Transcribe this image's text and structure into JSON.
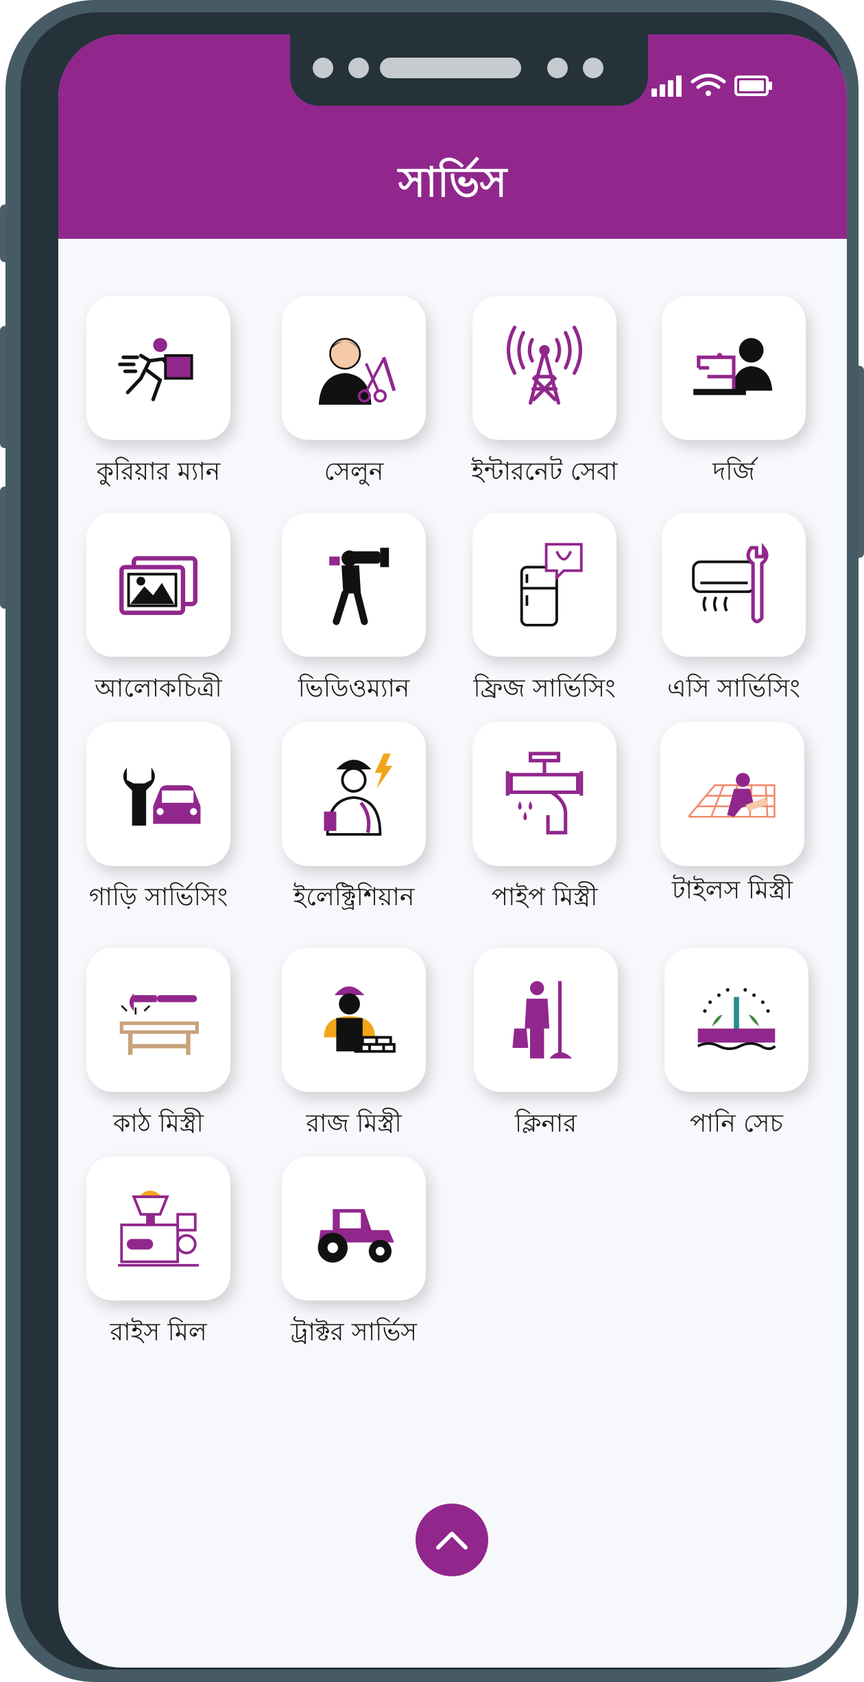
{
  "header": {
    "title": "সার্ভিস"
  },
  "colors": {
    "primary": "#91278c",
    "frame": "#475b66",
    "bezel": "#25323a",
    "background": "#f7f8fb"
  },
  "status_icons": [
    "signal-icon",
    "wifi-icon",
    "battery-icon"
  ],
  "services": [
    {
      "label": "কুরিয়ার ম্যান",
      "icon": "courier-icon"
    },
    {
      "label": "সেলুন",
      "icon": "salon-icon"
    },
    {
      "label": "ইন্টারনেট সেবা",
      "icon": "internet-tower-icon"
    },
    {
      "label": "দর্জি",
      "icon": "tailor-icon"
    },
    {
      "label": "আলোকচিত্রী",
      "icon": "photographer-icon"
    },
    {
      "label": "ভিডিওম্যান",
      "icon": "videographer-icon"
    },
    {
      "label": "ফ্রিজ সার্ভিসিং",
      "icon": "fridge-service-icon"
    },
    {
      "label": "এসি সার্ভিসিং",
      "icon": "ac-service-icon"
    },
    {
      "label": "গাড়ি সার্ভিসিং",
      "icon": "car-service-icon"
    },
    {
      "label": "ইলেক্ট্রিশিয়ান",
      "icon": "electrician-icon"
    },
    {
      "label": "পাইপ মিস্ত্রী",
      "icon": "plumber-icon"
    },
    {
      "label": "টাইলস মিস্ত্রী",
      "icon": "tiles-worker-icon"
    },
    {
      "label": "কাঠ মিস্ত্রী",
      "icon": "carpenter-icon"
    },
    {
      "label": "রাজ মিস্ত্রী",
      "icon": "mason-icon"
    },
    {
      "label": "ক্লিনার",
      "icon": "cleaner-icon"
    },
    {
      "label": "পানি সেচ",
      "icon": "irrigation-icon"
    },
    {
      "label": "রাইস মিল",
      "icon": "rice-mill-icon"
    },
    {
      "label": "ট্রাক্টর সার্ভিস",
      "icon": "tractor-icon"
    }
  ],
  "scroll_top": {
    "icon": "chevron-up-icon"
  }
}
